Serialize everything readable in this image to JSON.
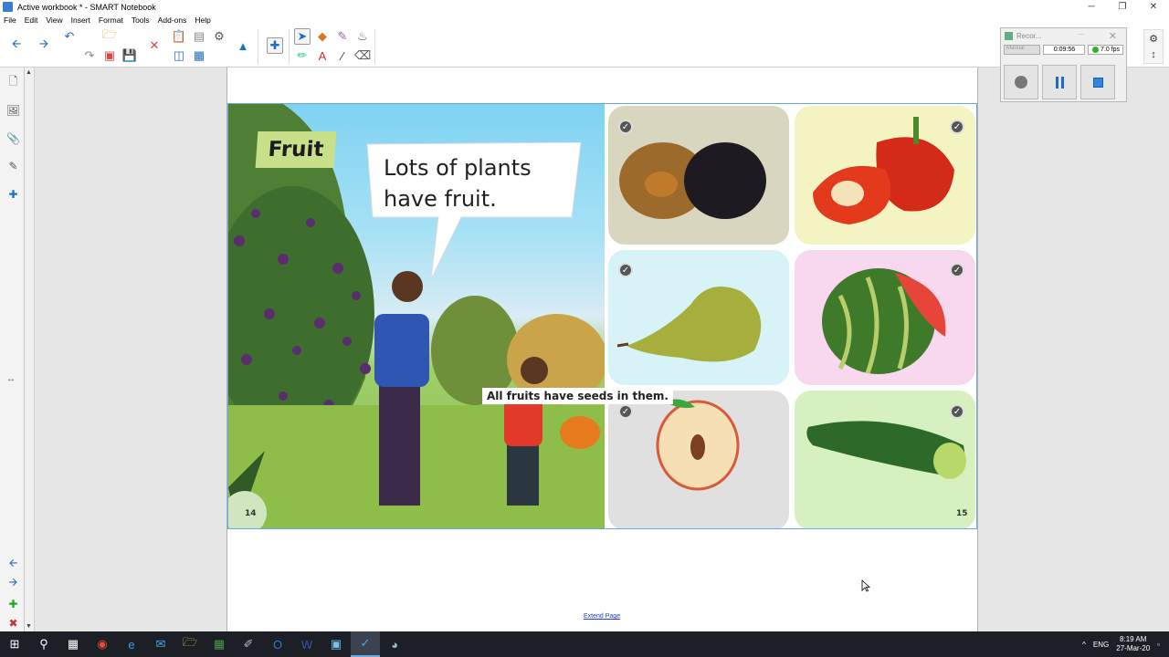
{
  "window": {
    "title": "Active workbook * - SMART Notebook",
    "minimize": "─",
    "restore": "❐",
    "close": "✕"
  },
  "menu": [
    "File",
    "Edit",
    "View",
    "Insert",
    "Format",
    "Tools",
    "Add-ons",
    "Help"
  ],
  "recorder": {
    "title": "Recor...",
    "mode": "Manual",
    "time": "0:09:56",
    "fps": "7.0 fps"
  },
  "page": {
    "label": "Fruit",
    "speech": "Lots of plants have fruit.",
    "caption": "All fruits have seeds in them.",
    "left_page_number": "14",
    "right_page_number": "15"
  },
  "extend_link": "Extend Page",
  "tray": {
    "lang": "ENG",
    "time": "8:19 AM",
    "date": "27-Mar-20",
    "chevron": "^"
  },
  "icons": {
    "check": "✓"
  },
  "colors": {
    "accent": "#1f6fc5",
    "taskbar": "#1c1f26",
    "fruit_label_bg": "#c8e08a"
  }
}
